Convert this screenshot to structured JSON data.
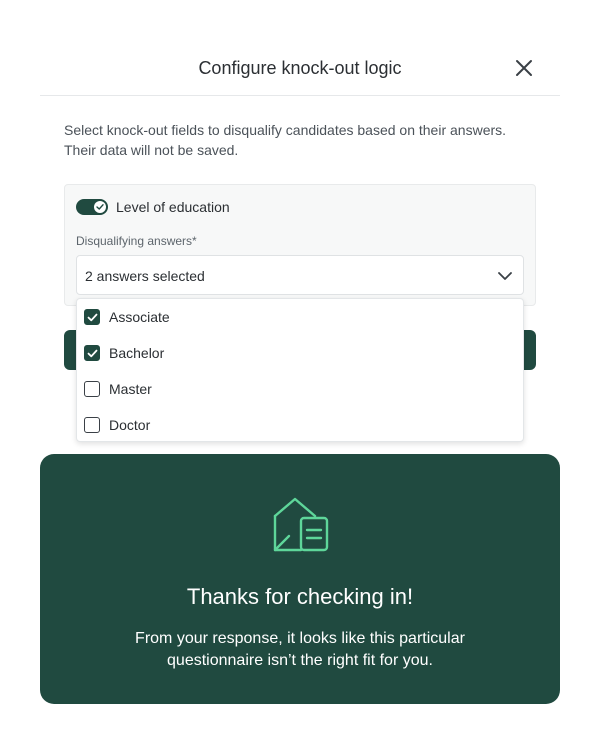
{
  "modal": {
    "title": "Configure knock-out logic",
    "description": "Select knock-out fields to disqualify candidates based on their answers. Their data will not be saved."
  },
  "field": {
    "toggle_on": true,
    "label": "Level of education",
    "disqualifying_label": "Disqualifying answers*",
    "select_value": "2 answers selected"
  },
  "options": [
    {
      "label": "Associate",
      "checked": true
    },
    {
      "label": "Bachelor",
      "checked": true
    },
    {
      "label": "Master",
      "checked": false
    },
    {
      "label": "Doctor",
      "checked": false
    }
  ],
  "panel": {
    "title": "Thanks for checking in!",
    "message": "From your response, it looks like this particular questionnaire isn’t the right fit for you."
  },
  "colors": {
    "brand_dark": "#204a40",
    "accent_green": "#5ed69a"
  },
  "icons": {
    "close": "close-icon",
    "chevron": "chevron-down-icon",
    "envelope": "envelope-document-icon",
    "check": "check-icon"
  }
}
